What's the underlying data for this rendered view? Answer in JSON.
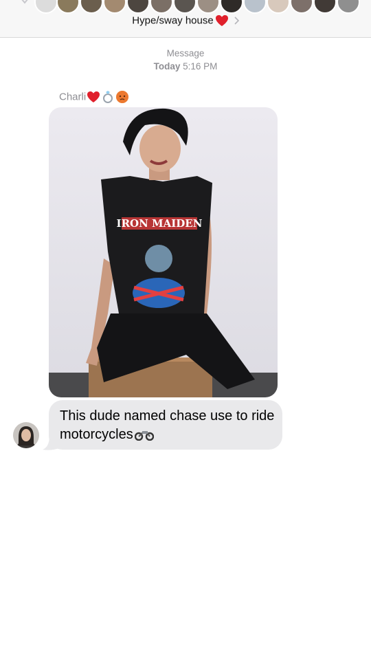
{
  "header": {
    "group_name": "Hype/sway house",
    "group_emoji": "red-heart-icon"
  },
  "timestamp": {
    "service": "Message",
    "day": "Today",
    "time": "5:16 PM"
  },
  "message": {
    "sender_name": "Charli",
    "sender_emojis": [
      "red-heart-icon",
      "ring-icon",
      "blushing-face-icon"
    ],
    "photo_shirt_text": "IRON MAIDEN",
    "text": "This dude named chase use to ride motorcycles",
    "text_emoji": "motorcycle-icon"
  },
  "colors": {
    "bubble": "#e9e9eb",
    "timestamp": "#8e8e93",
    "header_bg": "#f7f7f7"
  }
}
